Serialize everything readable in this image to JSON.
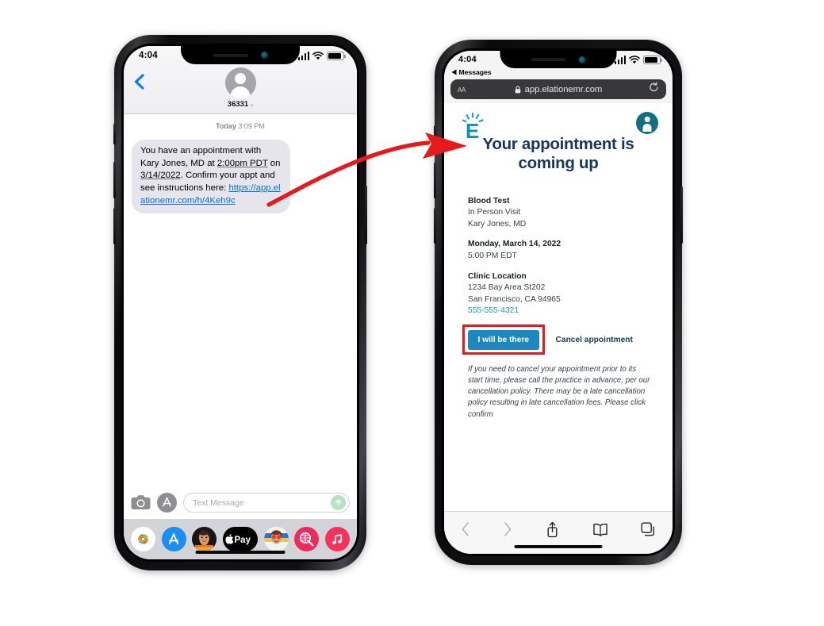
{
  "left_phone": {
    "app": "Messages",
    "statusbar": {
      "time": "4:04"
    },
    "header": {
      "back_icon": "chevron-left-icon",
      "avatar_icon": "person-avatar-icon",
      "contact_name": "36331",
      "detail_chevron": "›"
    },
    "conversation": {
      "timestamp_day": "Today",
      "timestamp_time": "3:09 PM",
      "message": {
        "part1": "You have an appointment with Kary Jones, MD at ",
        "time_underlined": "2:00pm PDT",
        "part2": " on ",
        "date_underlined": "3/14/2022",
        "part3": ". Confirm your appt and see instructions here: ",
        "link": "https://app.elationemr.com/h/4Keh9c"
      }
    },
    "input_bar": {
      "camera_icon": "camera-icon",
      "appstore_icon": "app-store-icon",
      "placeholder": "Text Message",
      "send_icon": "send-arrow-up-icon"
    },
    "dock": [
      {
        "name": "photos-app-icon",
        "label": "Photos"
      },
      {
        "name": "app-store-app-icon",
        "label": "App Store"
      },
      {
        "name": "memoji-app-icon",
        "label": "Memoji"
      },
      {
        "name": "apple-pay-app-icon",
        "label": "Apple Pay"
      },
      {
        "name": "animoji-app-icon",
        "label": "Animoji"
      },
      {
        "name": "images-search-app-icon",
        "label": "#images"
      },
      {
        "name": "music-app-icon",
        "label": "Music"
      }
    ]
  },
  "right_phone": {
    "app": "Safari",
    "statusbar": {
      "time": "4:04",
      "back_app_label": "Messages",
      "back_app_icon": "triangle-left-icon"
    },
    "browser": {
      "text_size_label": "AA",
      "lock_icon": "lock-icon",
      "url": "app.elationemr.com",
      "reload_icon": "reload-icon"
    },
    "page": {
      "logo_name": "elation-health-logo",
      "logo_letter": "E",
      "info_icon": "person-info-badge-icon",
      "title": "Your appointment is coming up",
      "appointment": {
        "type": "Blood Test",
        "visit_mode": "In Person Visit",
        "provider": "Kary Jones, MD",
        "date": "Monday, March 14, 2022",
        "time": "5:00 PM EDT"
      },
      "location": {
        "heading": "Clinic Location",
        "address_line1": "1234 Bay Area St202",
        "address_line2": "San Francisco, CA 94965",
        "phone": "555-555-4321"
      },
      "actions": {
        "confirm_label": "I will be there",
        "cancel_label": "Cancel appointment",
        "highlight_color": "#e8191b",
        "confirm_color": "#1e87bd"
      },
      "disclaimer": "If you need to cancel your appointment prior to its start time, please call the practice in advance, per our cancellation policy. There may be a late cancellation policy resulting in late cancellation fees. Please click confirm"
    },
    "toolbar": [
      {
        "name": "back-icon",
        "glyph": "‹"
      },
      {
        "name": "forward-icon",
        "glyph": "›"
      },
      {
        "name": "share-icon",
        "glyph": "share"
      },
      {
        "name": "bookmarks-icon",
        "glyph": "book"
      },
      {
        "name": "tabs-icon",
        "glyph": "tabs"
      }
    ]
  },
  "annotation": {
    "arrow_name": "flow-arrow",
    "arrow_color": "#e8191b"
  }
}
